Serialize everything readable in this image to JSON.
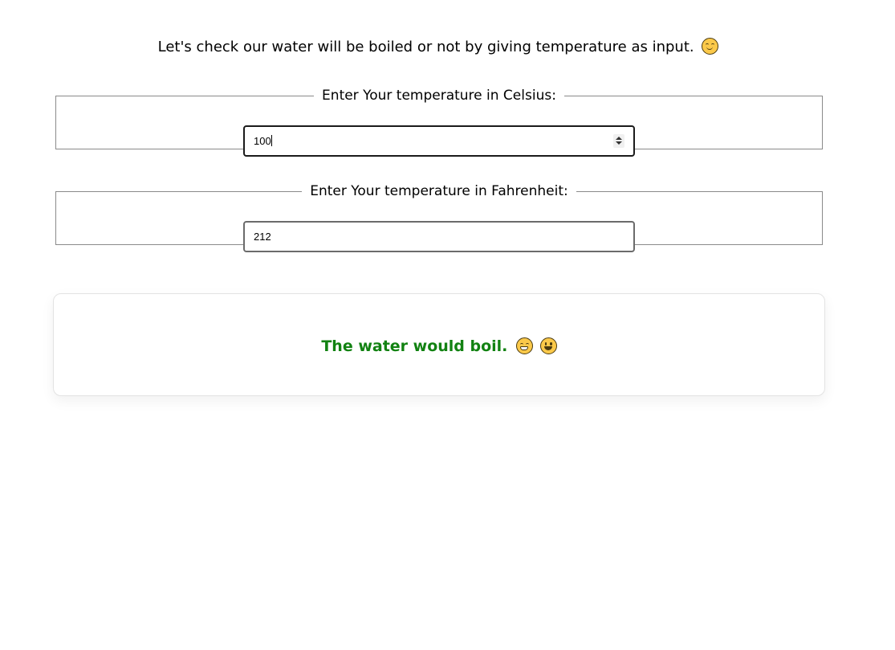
{
  "intro": {
    "text": "Let's check our water will be boiled or not by giving temperature as input."
  },
  "celsius": {
    "legend": "Enter Your temperature in Celsius:",
    "value": "100"
  },
  "fahrenheit": {
    "legend": "Enter Your temperature in Fahrenheit:",
    "value": "212"
  },
  "result": {
    "message": "The water would boil.",
    "color": "#128212"
  },
  "icons": [
    "smiling-face-icon",
    "grinning-face-icon",
    "grinning-face-open-icon"
  ]
}
